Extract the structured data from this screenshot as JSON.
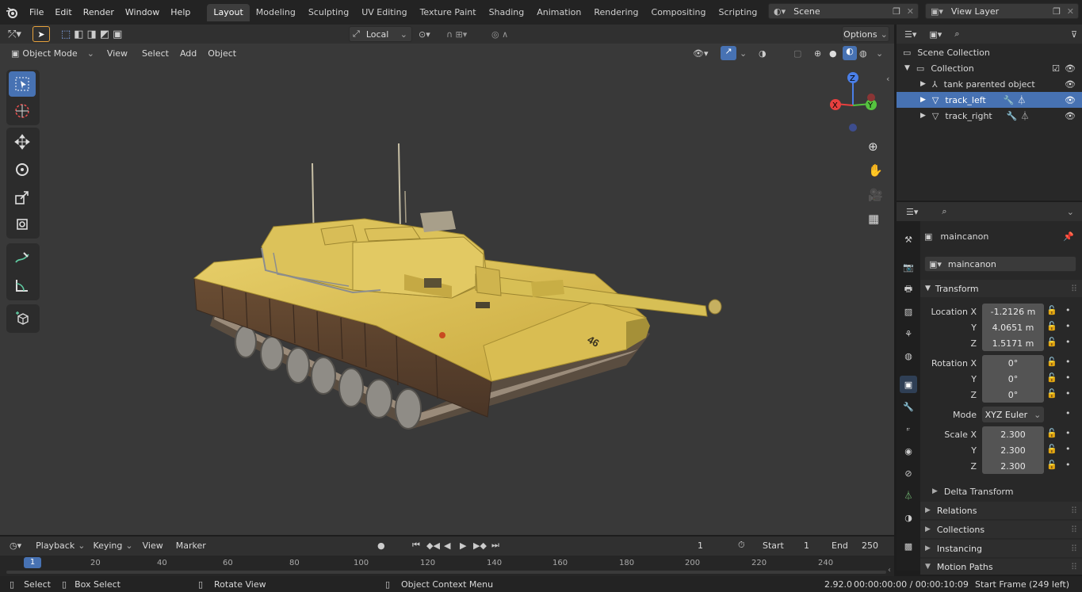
{
  "topbar": {
    "menus": [
      "File",
      "Edit",
      "Render",
      "Window",
      "Help"
    ],
    "workspaces": [
      "Layout",
      "Modeling",
      "Sculpting",
      "UV Editing",
      "Texture Paint",
      "Shading",
      "Animation",
      "Rendering",
      "Compositing",
      "Scripting"
    ],
    "active_workspace": "Layout",
    "add_tab": "+",
    "scene": "Scene",
    "view_layer": "View Layer"
  },
  "viewport": {
    "transform_orientation": "Local",
    "options_label": "Options",
    "mode": "Object Mode",
    "menus": [
      "View",
      "Select",
      "Add",
      "Object"
    ],
    "tank_number": "46"
  },
  "gizmo": {
    "x": "X",
    "y": "Y",
    "z": "Z"
  },
  "outliner": {
    "root": "Scene Collection",
    "collection": "Collection",
    "items": [
      {
        "label": "tank parented object",
        "selected": false
      },
      {
        "label": "track_left",
        "selected": true
      },
      {
        "label": "track_right",
        "selected": false
      }
    ]
  },
  "properties": {
    "object_name": "maincanon",
    "data_name": "maincanon",
    "transform_label": "Transform",
    "location_label": "Location X",
    "rotation_label": "Rotation X",
    "scale_label": "Scale X",
    "y_label": "Y",
    "z_label": "Z",
    "mode_label": "Mode",
    "location": [
      "-1.2126 m",
      "4.0651 m",
      "1.5171 m"
    ],
    "rotation": [
      "0°",
      "0°",
      "0°"
    ],
    "mode": "XYZ Euler",
    "scale": [
      "2.300",
      "2.300",
      "2.300"
    ],
    "delta_transform": "Delta Transform",
    "panels": [
      "Relations",
      "Collections",
      "Instancing",
      "Motion Paths"
    ]
  },
  "timeline": {
    "menus": [
      "Playback",
      "Keying",
      "View",
      "Marker"
    ],
    "current_frame": "1",
    "start_label": "Start",
    "start": "1",
    "end_label": "End",
    "end": "250",
    "ticks": [
      "20",
      "40",
      "60",
      "80",
      "100",
      "120",
      "140",
      "160",
      "180",
      "200",
      "220",
      "240"
    ],
    "cursor_frame": "1"
  },
  "statusbar": {
    "select": "Select",
    "box_select": "Box Select",
    "rotate_view": "Rotate View",
    "context_menu": "Object Context Menu",
    "version": "2.92.0",
    "time": "00:00:00:00 / 00:00:10:09",
    "frames_left": "Start Frame (249 left)"
  },
  "colors": {
    "accent": "#4772b3",
    "x_axis": "#e8403f",
    "y_axis": "#55c23f",
    "z_axis": "#4a7fe8",
    "frame_marker": "#4772b3"
  }
}
